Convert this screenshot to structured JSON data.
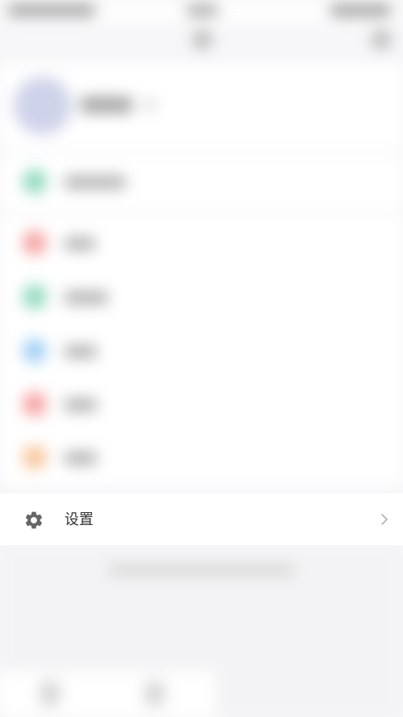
{
  "settings": {
    "label": "设置",
    "icon": "gear-icon",
    "chevron_icon": "chevron-right-icon"
  },
  "colors": {
    "row_icon_colors": [
      "#8fd9bd",
      "#f6a1a1",
      "#8fd9bd",
      "#9ecff5",
      "#f6a1a1",
      "#f8c59a"
    ],
    "avatar": "#cfd3ea",
    "settings_icon": "#666666",
    "chevron": "#b5b5b5"
  }
}
